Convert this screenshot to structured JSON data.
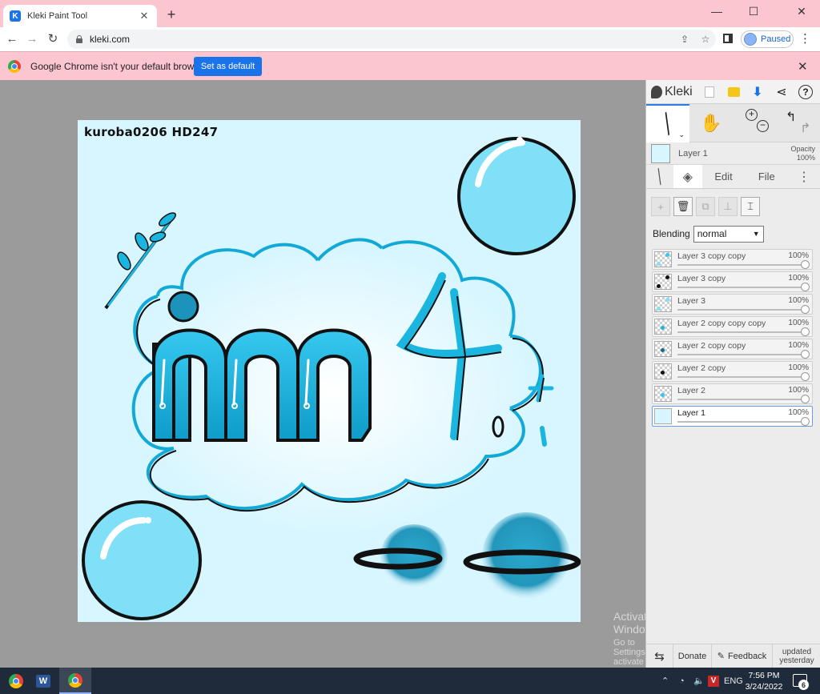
{
  "browser": {
    "tab_title": "Kleki Paint Tool",
    "tab_close": "✕",
    "new_tab": "+",
    "url": "kleki.com",
    "profile_status": "Paused",
    "window_controls": {
      "minimize": "—",
      "maximize": "☐",
      "close": "✕"
    },
    "nav": {
      "back": "←",
      "forward": "→",
      "reload": "↻"
    }
  },
  "infobar": {
    "message": "Google Chrome isn't your default browser",
    "button_label": "Set as default",
    "close": "✕"
  },
  "artwork": {
    "caption": "kuroba0206   HD247",
    "colors": {
      "background": "#d8f6ff",
      "accent": "#1ab6e0",
      "bubble": "#7fe0f7",
      "outline": "#111111"
    }
  },
  "kleki": {
    "logo_text": "Kleki",
    "current_layer": {
      "name": "Layer 1",
      "opacity_label": "Opacity",
      "opacity_value": "100%"
    },
    "tabs": {
      "edit": "Edit",
      "file": "File"
    },
    "blending": {
      "label": "Blending",
      "mode": "normal"
    },
    "layers": [
      {
        "name": "Layer 3 copy copy",
        "opacity": "100%",
        "selected": false
      },
      {
        "name": "Layer 3 copy",
        "opacity": "100%",
        "selected": false
      },
      {
        "name": "Layer 3",
        "opacity": "100%",
        "selected": false
      },
      {
        "name": "Layer 2 copy copy copy",
        "opacity": "100%",
        "selected": false
      },
      {
        "name": "Layer 2 copy copy",
        "opacity": "100%",
        "selected": false
      },
      {
        "name": "Layer 2 copy",
        "opacity": "100%",
        "selected": false
      },
      {
        "name": "Layer 2",
        "opacity": "100%",
        "selected": false
      },
      {
        "name": "Layer 1",
        "opacity": "100%",
        "selected": true
      }
    ],
    "bottom": {
      "donate": "Donate",
      "feedback": "Feedback",
      "updated_line1": "updated",
      "updated_line2": "yesterday"
    }
  },
  "watermark": {
    "line1": "Activate Windows",
    "line2": "Go to Settings to activate Windows."
  },
  "taskbar": {
    "language": "ENG",
    "time": "7:56 PM",
    "date": "3/24/2022",
    "notification_count": "6",
    "word_letter": "W",
    "vpn_letter": "V"
  }
}
